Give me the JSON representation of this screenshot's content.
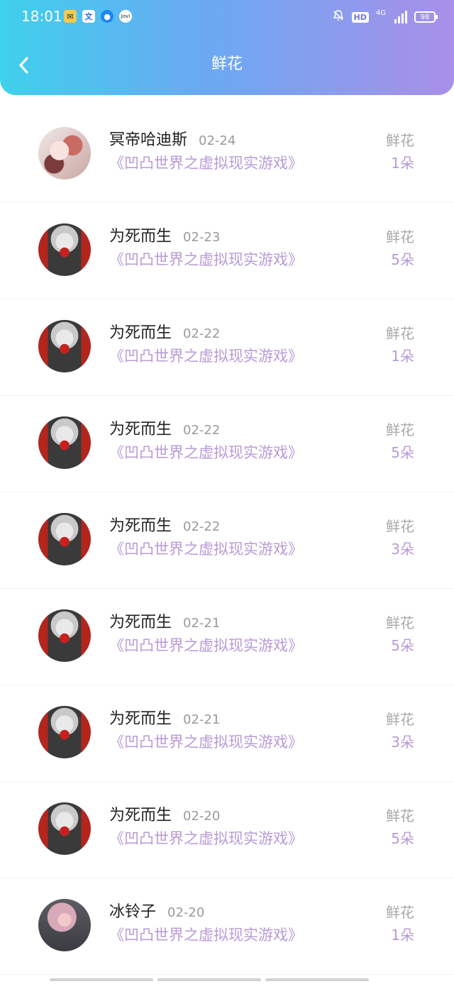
{
  "status_bar": {
    "time": "18:01",
    "hd": "HD",
    "network": "4G",
    "battery": "98"
  },
  "header": {
    "title": "鲜花"
  },
  "items": [
    {
      "name": "冥帝哈迪斯",
      "date": "02-24",
      "book": "《凹凸世界之虚拟现实游戏》",
      "gift": "鲜花",
      "count": "1朵",
      "avatar": "a1"
    },
    {
      "name": "为死而生",
      "date": "02-23",
      "book": "《凹凸世界之虚拟现实游戏》",
      "gift": "鲜花",
      "count": "5朵",
      "avatar": "a2"
    },
    {
      "name": "为死而生",
      "date": "02-22",
      "book": "《凹凸世界之虚拟现实游戏》",
      "gift": "鲜花",
      "count": "1朵",
      "avatar": "a2"
    },
    {
      "name": "为死而生",
      "date": "02-22",
      "book": "《凹凸世界之虚拟现实游戏》",
      "gift": "鲜花",
      "count": "5朵",
      "avatar": "a2"
    },
    {
      "name": "为死而生",
      "date": "02-22",
      "book": "《凹凸世界之虚拟现实游戏》",
      "gift": "鲜花",
      "count": "3朵",
      "avatar": "a2"
    },
    {
      "name": "为死而生",
      "date": "02-21",
      "book": "《凹凸世界之虚拟现实游戏》",
      "gift": "鲜花",
      "count": "5朵",
      "avatar": "a2"
    },
    {
      "name": "为死而生",
      "date": "02-21",
      "book": "《凹凸世界之虚拟现实游戏》",
      "gift": "鲜花",
      "count": "3朵",
      "avatar": "a2"
    },
    {
      "name": "为死而生",
      "date": "02-20",
      "book": "《凹凸世界之虚拟现实游戏》",
      "gift": "鲜花",
      "count": "5朵",
      "avatar": "a2"
    },
    {
      "name": "冰铃子",
      "date": "02-20",
      "book": "《凹凸世界之虚拟现实游戏》",
      "gift": "鲜花",
      "count": "1朵",
      "avatar": "a3"
    }
  ]
}
